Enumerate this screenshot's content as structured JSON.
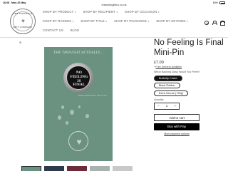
{
  "status_bar": {
    "time": "16:08",
    "date": "Mon 26 May",
    "url": "chiswickgiftco.co.uk",
    "battery": "80%"
  },
  "header": {
    "logo_top": "THE CHISWICK",
    "logo_bottom": "GIFT COMPANY",
    "nav_rows": [
      [
        "SHOP BY PRODUCT",
        "SHOP BY RECIPIENT",
        "SHOP BY OCCASION"
      ],
      [
        "SHOP BY RANGES",
        "SHOP BY TITLE",
        "SHOP BY PIN BADGE",
        "SHOP BY KEYRING"
      ],
      [
        "CONTACT US",
        "BLOG"
      ]
    ]
  },
  "product": {
    "card_top_text": "THE THOUGHT ACTUALLY...",
    "pin_lines": [
      "NO",
      "FEELING",
      "IS",
      "FINAL"
    ],
    "card_brand": "THE CHISWICK GIFT CO",
    "title": "No Feeling Is Final Mini-Pin",
    "price": "£7.00",
    "shipping_link": "Free Delivery Available",
    "option_label": "Which Backing Clasp Would You Prefer?",
    "options": [
      "Butterfly Clutch",
      "Black Rubber",
      "Extra Secure (+50p)"
    ],
    "selected_option": "Butterfly Clutch",
    "quantity_label": "Quantity",
    "quantity": "1",
    "minus": "−",
    "plus": "+",
    "add_to_cart": "Add to cart",
    "buy_with": "Buy with",
    "pay_brand": "Pay",
    "more_payment": "More payment options"
  },
  "thumbnails": [
    "thumb-1",
    "thumb-2",
    "thumb-3",
    "thumb-4",
    "thumb-5"
  ]
}
